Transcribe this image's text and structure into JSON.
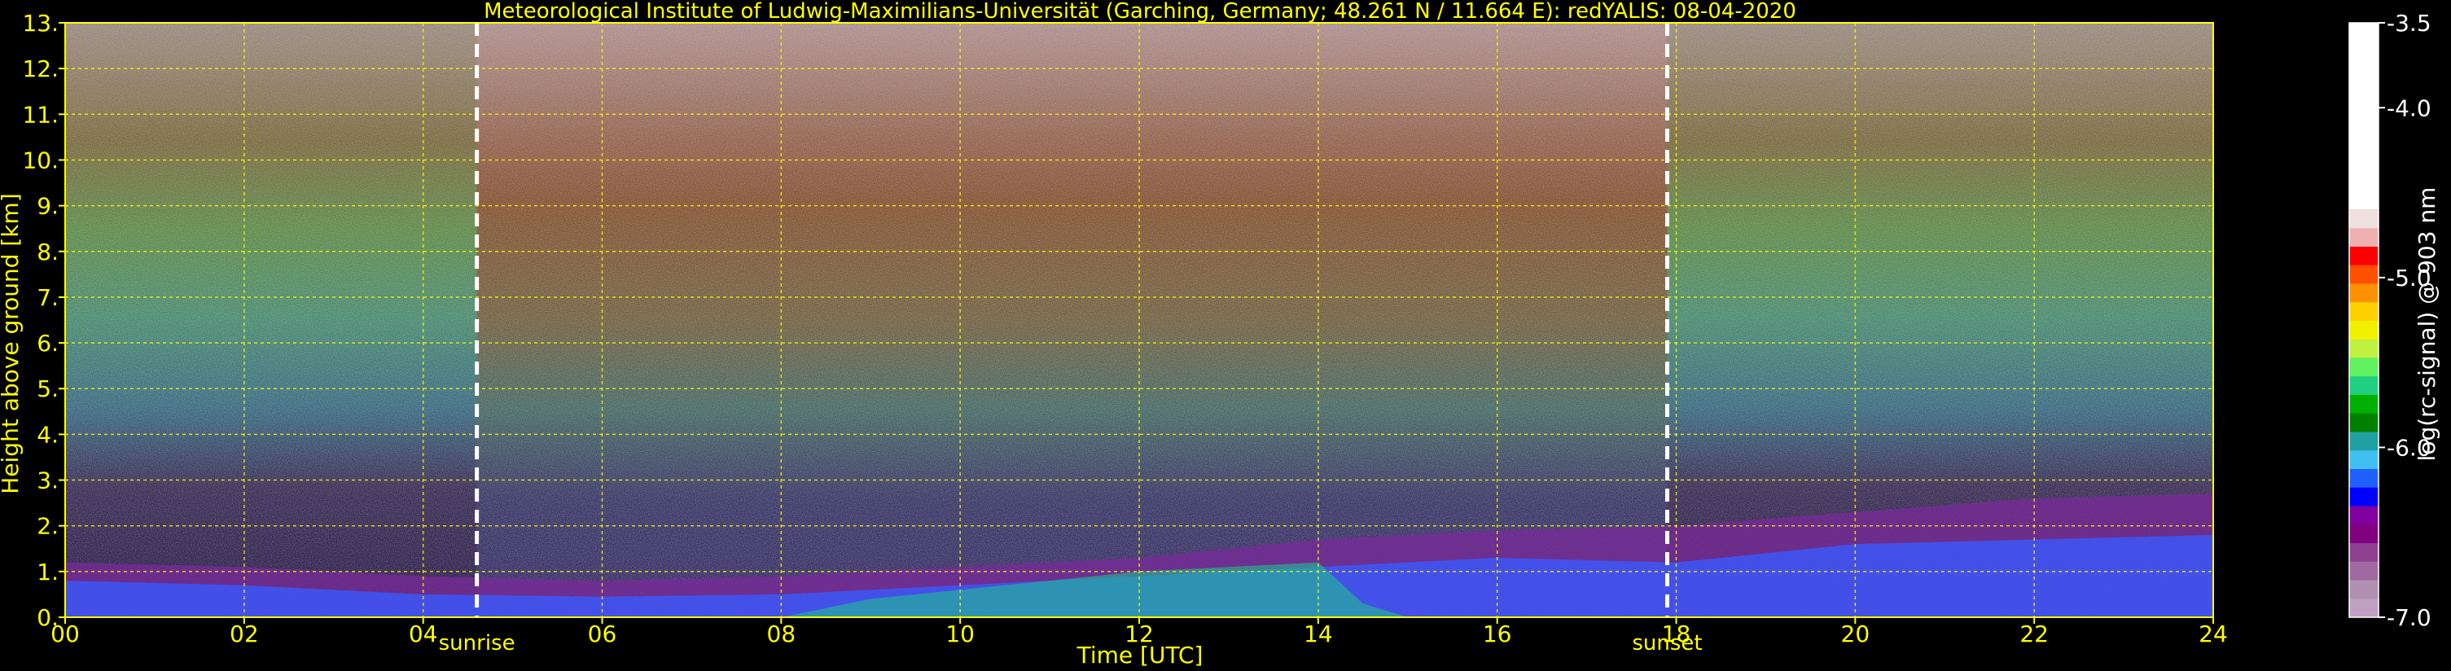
{
  "chart_data": {
    "type": "heatmap",
    "title": "Meteorological Institute of Ludwig-Maximilians-Universität (Garching, Germany; 48.261 N / 11.664 E):    redYALIS: 08-04-2020",
    "xlabel": "Time [UTC]",
    "ylabel": "Height above ground [km]",
    "xlim": [
      0,
      24
    ],
    "ylim": [
      0,
      13
    ],
    "x_ticks": [
      "00",
      "02",
      "04",
      "06",
      "08",
      "10",
      "12",
      "14",
      "16",
      "18",
      "20",
      "22",
      "24"
    ],
    "y_ticks": [
      "0.",
      "1.",
      "2.",
      "3.",
      "4.",
      "5.",
      "6.",
      "7.",
      "8.",
      "9.",
      "10.",
      "11.",
      "12.",
      "13."
    ],
    "grid": true,
    "annotations": [
      {
        "label": "sunrise",
        "x": 4.6
      },
      {
        "label": "sunset",
        "x": 17.9
      }
    ],
    "colorbar": {
      "label": "log(rc-signal) @ 903 nm",
      "range": [
        -7.0,
        -3.5
      ],
      "ticks": [
        "-3.5",
        "-4.0",
        "-5.0",
        "-6.0",
        "-7.0"
      ],
      "colors": [
        "#ffffff",
        "#f0e0e0",
        "#f0b0b0",
        "#ff0000",
        "#ff5000",
        "#ff9000",
        "#ffd000",
        "#f0f000",
        "#c0f040",
        "#60f060",
        "#20d080",
        "#00b000",
        "#008000",
        "#20a0a0",
        "#40c0f0",
        "#2060ff",
        "#0000ff",
        "#8000a0",
        "#800080",
        "#904090",
        "#a06aa0",
        "#b090b0",
        "#c0a0c0"
      ]
    },
    "text_color": "#ffff00"
  }
}
